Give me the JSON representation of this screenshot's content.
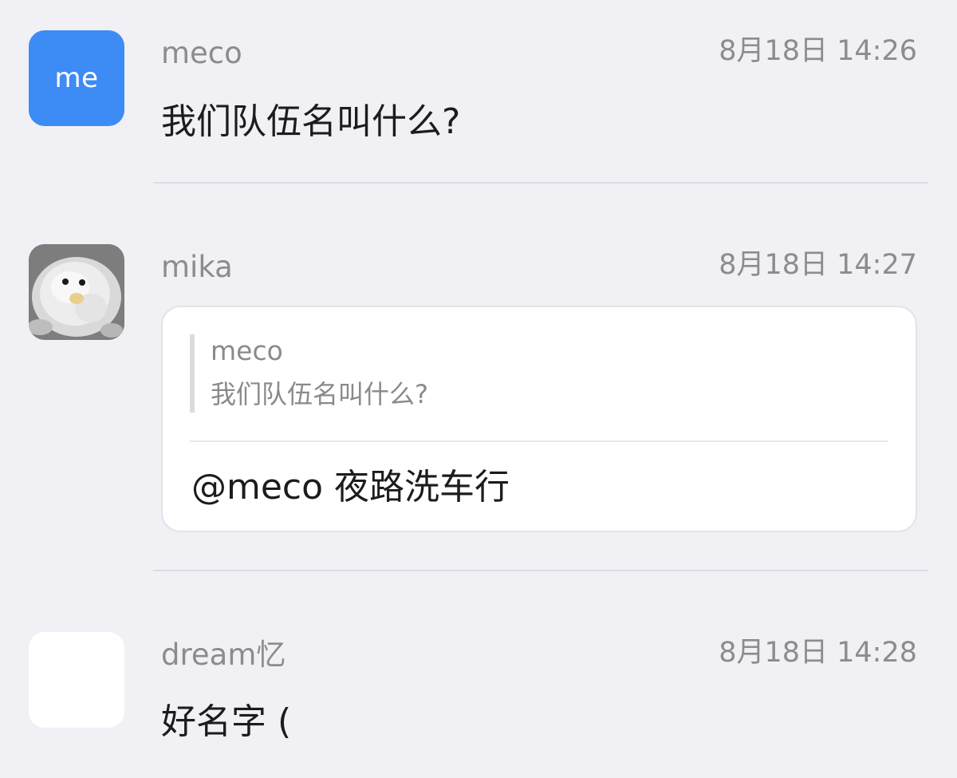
{
  "messages": [
    {
      "avatar_text": "me",
      "avatar_color": "#3d8bf5",
      "sender": "meco",
      "time": "8月18日 14:26",
      "text": "我们队伍名叫什么?"
    },
    {
      "avatar_icon": "plush-bird-photo",
      "sender": "mika",
      "time": "8月18日 14:27",
      "quote": {
        "sender": "meco",
        "text": "我们队伍名叫什么?"
      },
      "text": "@meco 夜路洗车行"
    },
    {
      "avatar_icon": "blank-avatar",
      "sender": "dream忆",
      "time": "8月18日 14:28",
      "text": "好名字 ("
    }
  ]
}
